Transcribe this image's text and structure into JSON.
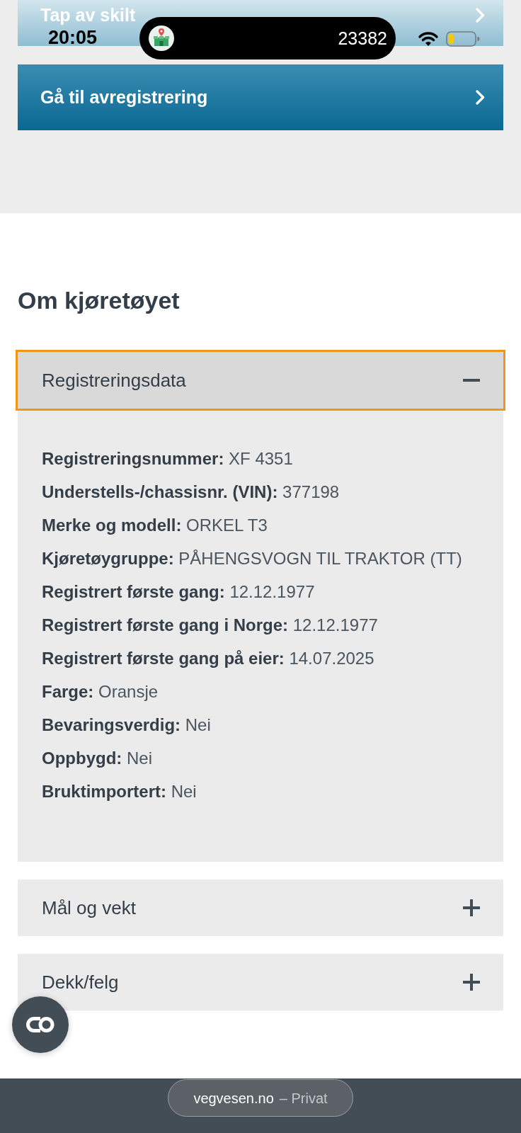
{
  "status_bar": {
    "time": "20:05",
    "live_activity": "23382"
  },
  "links": [
    {
      "kind": "light",
      "label": "Tap av skilt"
    },
    {
      "kind": "primary",
      "label": "Gå til avregistrering"
    }
  ],
  "section": {
    "heading": "Om kjøretøyet",
    "accordion": [
      {
        "title": "Registreringsdata",
        "expanded": true,
        "focused": true,
        "fields": [
          {
            "label": "Registreringsnummer:",
            "value": "XF 4351"
          },
          {
            "label": "Understells-/chassisnr. (VIN):",
            "value": "377198"
          },
          {
            "label": "Merke og modell:",
            "value": "ORKEL T3"
          },
          {
            "label": "Kjøretøygruppe:",
            "value": "PÅHENGSVOGN TIL TRAKTOR (TT)"
          },
          {
            "label": "Registrert første gang:",
            "value": "12.12.1977"
          },
          {
            "label": "Registrert første gang i Norge:",
            "value": "12.12.1977"
          },
          {
            "label": "Registrert første gang på eier:",
            "value": "14.07.2025"
          },
          {
            "label": "Farge:",
            "value": "Oransje"
          },
          {
            "label": "Bevaringsverdig:",
            "value": "Nei"
          },
          {
            "label": "Oppbygd:",
            "value": "Nei"
          },
          {
            "label": "Bruktimportert:",
            "value": "Nei"
          }
        ]
      },
      {
        "title": "Mål og vekt",
        "expanded": false,
        "focused": false
      },
      {
        "title": "Dekk/felg",
        "expanded": false,
        "focused": false
      }
    ]
  },
  "browser_bar": {
    "domain": "vegvesen.no",
    "mode": "– Privat"
  }
}
